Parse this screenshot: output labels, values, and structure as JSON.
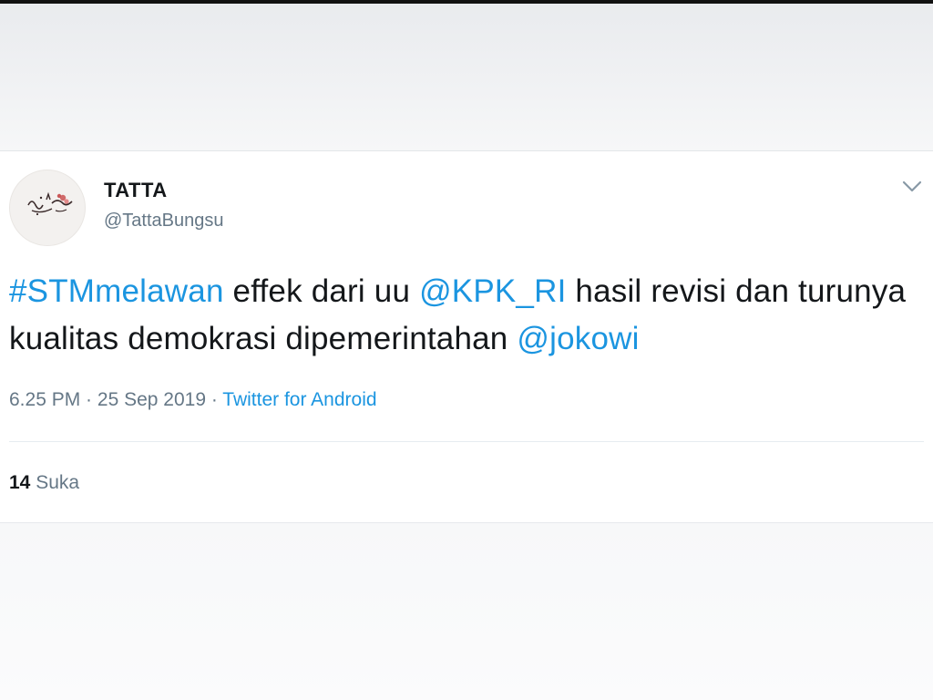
{
  "tweet": {
    "display_name": "TATTA",
    "handle": "@TattaBungsu",
    "body": {
      "hashtag": "#STMmelawan",
      "text_1": " effek dari uu ",
      "mention_1": "@KPK_RI",
      "text_2": " hasil revisi dan turunya kualitas demokrasi dipemerintahan ",
      "mention_2": "@jokowi"
    },
    "time": "6.25 PM",
    "separator_1": " · ",
    "date": "25 Sep 2019",
    "separator_2": " · ",
    "source": "Twitter for Android",
    "likes_count": "14",
    "likes_label": " Suka"
  },
  "icons": {
    "caret": "chevron-down-icon",
    "avatar": "avatar"
  },
  "colors": {
    "link": "#1b95e0",
    "text_primary": "#14171a",
    "text_secondary": "#657786",
    "divider": "#e6ecf0"
  }
}
